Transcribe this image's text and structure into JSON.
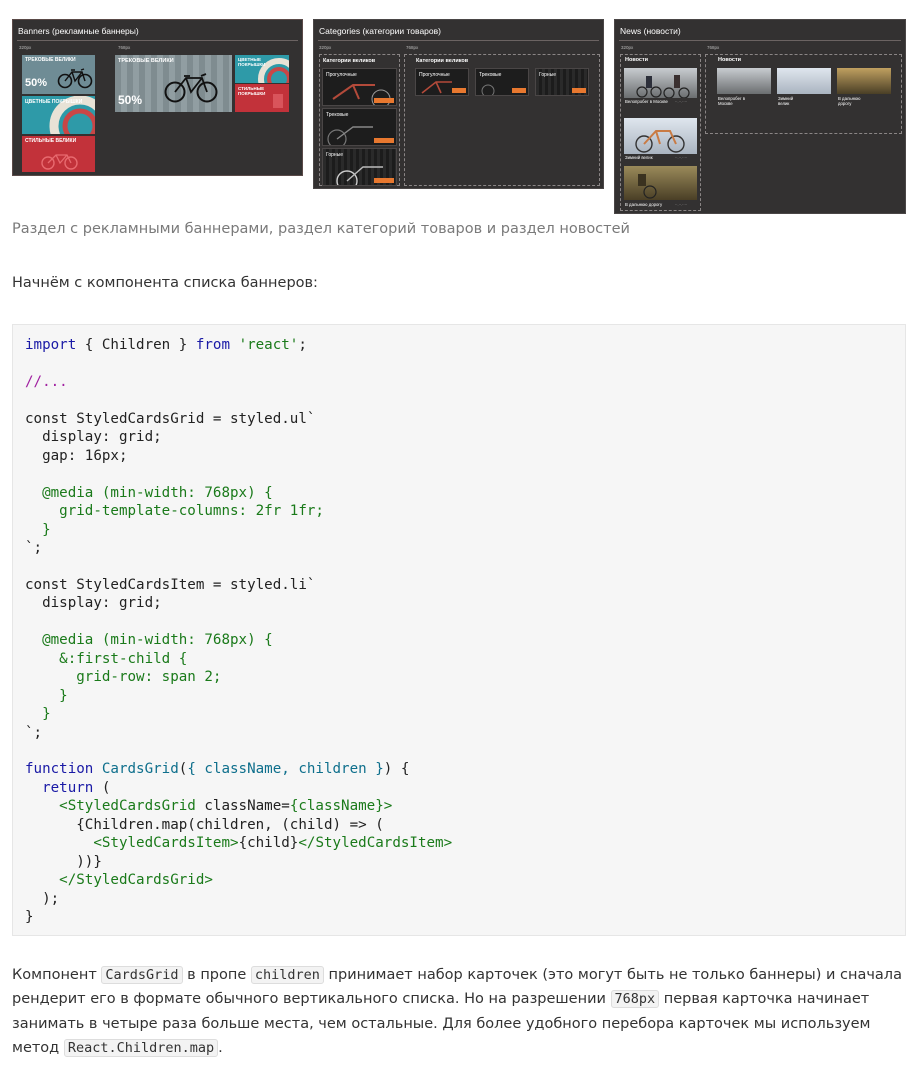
{
  "mockups": {
    "banners": {
      "title": "Banners (рекламные баннеры)",
      "size_small": "320px",
      "size_large": "768px",
      "b1_text": "ТРЕКОВЫЕ ВЕЛИКИ",
      "b1_big": "50%",
      "b2_text": "ЦВЕТНЫЕ ПОКРЫШКИ",
      "b3_text": "СТИЛЬНЫЕ ВЕЛИКИ",
      "l1_text": "ТРЕКОВЫЕ ВЕЛИКИ",
      "l1_big": "50%",
      "l2_text": "ЦВЕТНЫЕ ПОКРЫШКИ",
      "l3_text": "СТИЛЬНЫЕ ПОКРЫШКИ"
    },
    "categories": {
      "title": "Categories (категории товаров)",
      "size_small": "320px",
      "size_large": "768px",
      "heading": "Категории великов",
      "items": [
        "Прогулочные",
        "Трековые",
        "Горные"
      ]
    },
    "news": {
      "title": "News (новости)",
      "size_small": "320px",
      "size_large": "768px",
      "heading": "Новости",
      "items": [
        "Велопробег в Москве",
        "Зимний велик",
        "В дальнюю дорогу"
      ],
      "items_wide": [
        "Велопробег в Москве",
        "Зимний велик",
        "В дальнюю дорогу"
      ]
    }
  },
  "caption": "Раздел с рекламными баннерами, раздел категорий товаров и раздел новостей",
  "intro": "Начнём с компонента списка баннеров:",
  "paragraph": {
    "p1": "Компонент ",
    "code1": "CardsGrid",
    "p2": " в пропе ",
    "code2": "children",
    "p3": " принимает набор карточек (это могут быть не только баннеры) и сначала рендерит его в формате обычного вертикального списка. Но на разрешении ",
    "code3": "768px",
    "p4": " первая карточка начинает занимать в четыре раза больше места, чем остальные. Для более удобного перебора карточек мы используем метод ",
    "code4": "React.Children.map",
    "p5": "."
  },
  "colors": {
    "accent_orange": "#e8782f",
    "mockup_bg": "#333131",
    "code_bg": "#f6f6f6"
  }
}
